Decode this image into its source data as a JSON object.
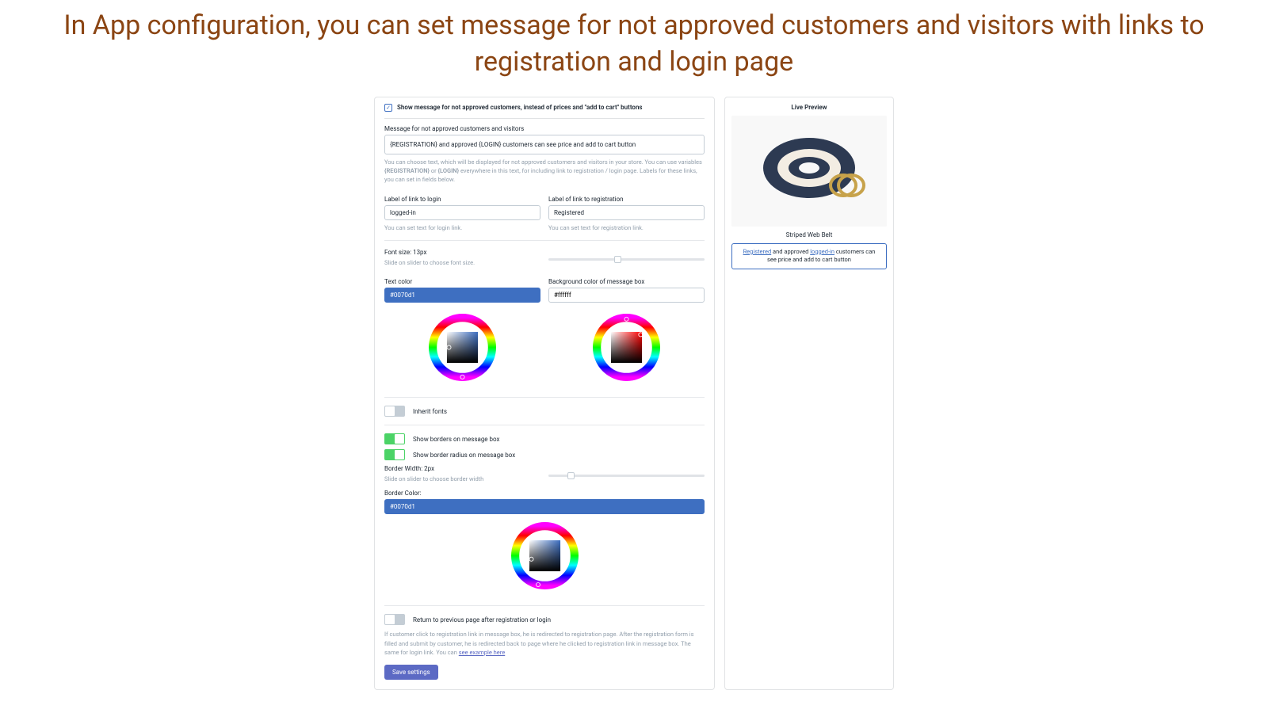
{
  "page_heading": "In App configuration, you can set message for not approved customers and visitors with links to registration and login page",
  "main": {
    "show_message_checkbox_label": "Show message for not approved customers, instead of prices and \"add to cart\" buttons",
    "show_message_checked": true,
    "message_field_label": "Message for not approved customers and visitors",
    "message_value": "{REGISTRATION} and approved {LOGIN} customers can see price and add to cart button",
    "message_help_pre": "You can choose text, which will be displayed for not approved customers and visitors in your store. You can use variables ",
    "message_help_var1": "{REGISTRATION}",
    "message_help_mid": " or ",
    "message_help_var2": "{LOGIN}",
    "message_help_post": " everywhere in this text, for including link to registration / login page. Labels for these links, you can set in fields below.",
    "login_label_field_label": "Label of link to login",
    "login_label_value": "logged-in",
    "login_label_help": "You can set text for login link.",
    "reg_label_field_label": "Label of link to registration",
    "reg_label_value": "Registered",
    "reg_label_help": "You can set text for registration link.",
    "font_size_label": "Font size: 13px",
    "font_size_value": 13,
    "font_size_help": "Slide on slider to choose font size.",
    "font_size_thumb_pct": 42,
    "text_color_label": "Text color",
    "text_color_value": "#0070d1",
    "bg_color_label": "Background color of message box",
    "bg_color_value": "#ffffff",
    "inherit_fonts_label": "Inherit fonts",
    "inherit_fonts_on": false,
    "show_borders_label": "Show borders on message box",
    "show_borders_on": true,
    "show_border_radius_label": "Show border radius on message box",
    "show_border_radius_on": true,
    "border_width_label": "Border Width: 2px",
    "border_width_value": 2,
    "border_width_help": "Slide on slider to choose border width",
    "border_width_thumb_pct": 12,
    "border_color_label": "Border Color:",
    "border_color_value": "#0070d1",
    "return_prev_label": "Return to previous page after registration or login",
    "return_prev_on": false,
    "return_prev_help_pre": "If customer click to registration link in message box, he is redirected to registration page. After the registration form is filled and submit by customer, he is redirected back to page where he clicked to registration link in message box. The same for login link. You can ",
    "return_prev_help_link": "see example here",
    "save_button_label": "Save settings"
  },
  "preview": {
    "title": "Live Preview",
    "product_name": "Striped Web Belt",
    "msg_link1": "Registered",
    "msg_mid1": " and approved ",
    "msg_link2": "logged-in",
    "msg_mid2": " customers can see price and add to cart button"
  }
}
